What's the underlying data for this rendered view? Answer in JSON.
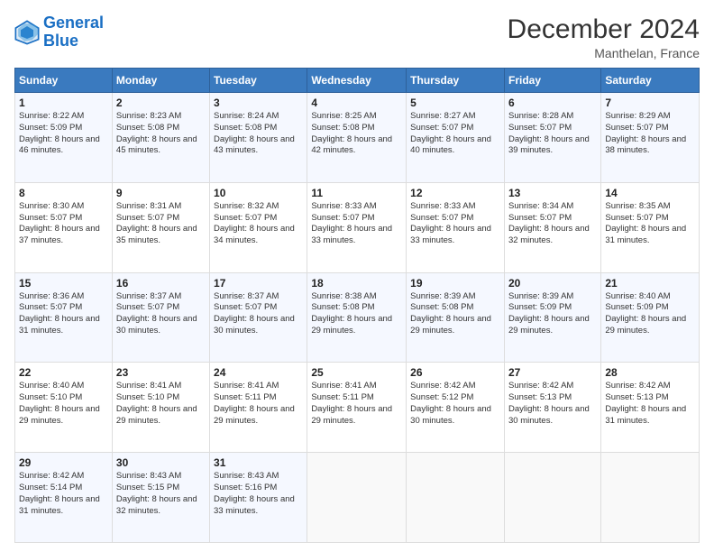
{
  "header": {
    "logo_line1": "General",
    "logo_line2": "Blue",
    "title": "December 2024",
    "subtitle": "Manthelan, France"
  },
  "weekdays": [
    "Sunday",
    "Monday",
    "Tuesday",
    "Wednesday",
    "Thursday",
    "Friday",
    "Saturday"
  ],
  "weeks": [
    [
      {
        "day": "1",
        "sunrise": "8:22 AM",
        "sunset": "5:09 PM",
        "daylight": "8 hours and 46 minutes."
      },
      {
        "day": "2",
        "sunrise": "8:23 AM",
        "sunset": "5:08 PM",
        "daylight": "8 hours and 45 minutes."
      },
      {
        "day": "3",
        "sunrise": "8:24 AM",
        "sunset": "5:08 PM",
        "daylight": "8 hours and 43 minutes."
      },
      {
        "day": "4",
        "sunrise": "8:25 AM",
        "sunset": "5:08 PM",
        "daylight": "8 hours and 42 minutes."
      },
      {
        "day": "5",
        "sunrise": "8:27 AM",
        "sunset": "5:07 PM",
        "daylight": "8 hours and 40 minutes."
      },
      {
        "day": "6",
        "sunrise": "8:28 AM",
        "sunset": "5:07 PM",
        "daylight": "8 hours and 39 minutes."
      },
      {
        "day": "7",
        "sunrise": "8:29 AM",
        "sunset": "5:07 PM",
        "daylight": "8 hours and 38 minutes."
      }
    ],
    [
      {
        "day": "8",
        "sunrise": "8:30 AM",
        "sunset": "5:07 PM",
        "daylight": "8 hours and 37 minutes."
      },
      {
        "day": "9",
        "sunrise": "8:31 AM",
        "sunset": "5:07 PM",
        "daylight": "8 hours and 35 minutes."
      },
      {
        "day": "10",
        "sunrise": "8:32 AM",
        "sunset": "5:07 PM",
        "daylight": "8 hours and 34 minutes."
      },
      {
        "day": "11",
        "sunrise": "8:33 AM",
        "sunset": "5:07 PM",
        "daylight": "8 hours and 33 minutes."
      },
      {
        "day": "12",
        "sunrise": "8:33 AM",
        "sunset": "5:07 PM",
        "daylight": "8 hours and 33 minutes."
      },
      {
        "day": "13",
        "sunrise": "8:34 AM",
        "sunset": "5:07 PM",
        "daylight": "8 hours and 32 minutes."
      },
      {
        "day": "14",
        "sunrise": "8:35 AM",
        "sunset": "5:07 PM",
        "daylight": "8 hours and 31 minutes."
      }
    ],
    [
      {
        "day": "15",
        "sunrise": "8:36 AM",
        "sunset": "5:07 PM",
        "daylight": "8 hours and 31 minutes."
      },
      {
        "day": "16",
        "sunrise": "8:37 AM",
        "sunset": "5:07 PM",
        "daylight": "8 hours and 30 minutes."
      },
      {
        "day": "17",
        "sunrise": "8:37 AM",
        "sunset": "5:07 PM",
        "daylight": "8 hours and 30 minutes."
      },
      {
        "day": "18",
        "sunrise": "8:38 AM",
        "sunset": "5:08 PM",
        "daylight": "8 hours and 29 minutes."
      },
      {
        "day": "19",
        "sunrise": "8:39 AM",
        "sunset": "5:08 PM",
        "daylight": "8 hours and 29 minutes."
      },
      {
        "day": "20",
        "sunrise": "8:39 AM",
        "sunset": "5:09 PM",
        "daylight": "8 hours and 29 minutes."
      },
      {
        "day": "21",
        "sunrise": "8:40 AM",
        "sunset": "5:09 PM",
        "daylight": "8 hours and 29 minutes."
      }
    ],
    [
      {
        "day": "22",
        "sunrise": "8:40 AM",
        "sunset": "5:10 PM",
        "daylight": "8 hours and 29 minutes."
      },
      {
        "day": "23",
        "sunrise": "8:41 AM",
        "sunset": "5:10 PM",
        "daylight": "8 hours and 29 minutes."
      },
      {
        "day": "24",
        "sunrise": "8:41 AM",
        "sunset": "5:11 PM",
        "daylight": "8 hours and 29 minutes."
      },
      {
        "day": "25",
        "sunrise": "8:41 AM",
        "sunset": "5:11 PM",
        "daylight": "8 hours and 29 minutes."
      },
      {
        "day": "26",
        "sunrise": "8:42 AM",
        "sunset": "5:12 PM",
        "daylight": "8 hours and 30 minutes."
      },
      {
        "day": "27",
        "sunrise": "8:42 AM",
        "sunset": "5:13 PM",
        "daylight": "8 hours and 30 minutes."
      },
      {
        "day": "28",
        "sunrise": "8:42 AM",
        "sunset": "5:13 PM",
        "daylight": "8 hours and 31 minutes."
      }
    ],
    [
      {
        "day": "29",
        "sunrise": "8:42 AM",
        "sunset": "5:14 PM",
        "daylight": "8 hours and 31 minutes."
      },
      {
        "day": "30",
        "sunrise": "8:43 AM",
        "sunset": "5:15 PM",
        "daylight": "8 hours and 32 minutes."
      },
      {
        "day": "31",
        "sunrise": "8:43 AM",
        "sunset": "5:16 PM",
        "daylight": "8 hours and 33 minutes."
      },
      null,
      null,
      null,
      null
    ]
  ]
}
